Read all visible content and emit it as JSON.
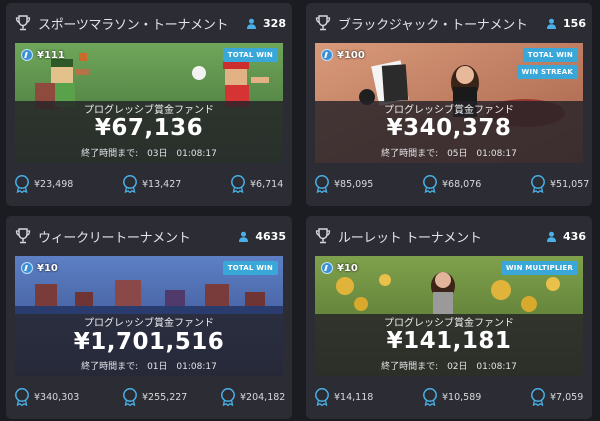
{
  "cards": [
    {
      "title": "スポーツマラソン・トーナメント",
      "players": "328",
      "entry_fee": "¥111",
      "badges": [
        "TOTAL WIN"
      ],
      "progressive_label": "プログレッシブ賞金ファンド",
      "jackpot": "¥67,136",
      "timer_label": "終了時間まで:",
      "timer_day": "03日",
      "timer_time": "01:08:17",
      "prizes": [
        "¥23,498",
        "¥13,427",
        "¥6,714"
      ],
      "theme": "sports"
    },
    {
      "title": "ブラックジャック・トーナメント",
      "players": "156",
      "entry_fee": "¥100",
      "badges": [
        "TOTAL WIN",
        "WIN STREAK"
      ],
      "progressive_label": "プログレッシブ賞金ファンド",
      "jackpot": "¥340,378",
      "timer_label": "終了時間まで:",
      "timer_day": "05日",
      "timer_time": "01:08:17",
      "prizes": [
        "¥85,095",
        "¥68,076",
        "¥51,057"
      ],
      "theme": "blackjack"
    },
    {
      "title": "ウィークリートーナメント",
      "players": "4635",
      "entry_fee": "¥10",
      "badges": [
        "TOTAL WIN"
      ],
      "progressive_label": "プログレッシブ賞金ファンド",
      "jackpot": "¥1,701,516",
      "timer_label": "終了時間まで:",
      "timer_day": "01日",
      "timer_time": "01:08:17",
      "prizes": [
        "¥340,303",
        "¥255,227",
        "¥204,182"
      ],
      "theme": "weekly"
    },
    {
      "title": "ルーレット トーナメント",
      "players": "436",
      "entry_fee": "¥10",
      "badges": [
        "WIN MULTIPLIER"
      ],
      "progressive_label": "プログレッシブ賞金ファンド",
      "jackpot": "¥141,181",
      "timer_label": "終了時間まで:",
      "timer_day": "02日",
      "timer_time": "01:08:17",
      "prizes": [
        "¥14,118",
        "¥10,589",
        "¥7,059"
      ],
      "theme": "roulette"
    }
  ],
  "colors": {
    "page_bg": "#1b1c22",
    "card_bg": "#2b2c34",
    "badge": "#3aa7d9",
    "medal": "#4ab0e6",
    "user_icon": "#4ab0e6"
  },
  "icons": {
    "title": "trophy-icon",
    "players": "user-icon",
    "entry": "coin-icon",
    "prize": "medal-icon"
  }
}
